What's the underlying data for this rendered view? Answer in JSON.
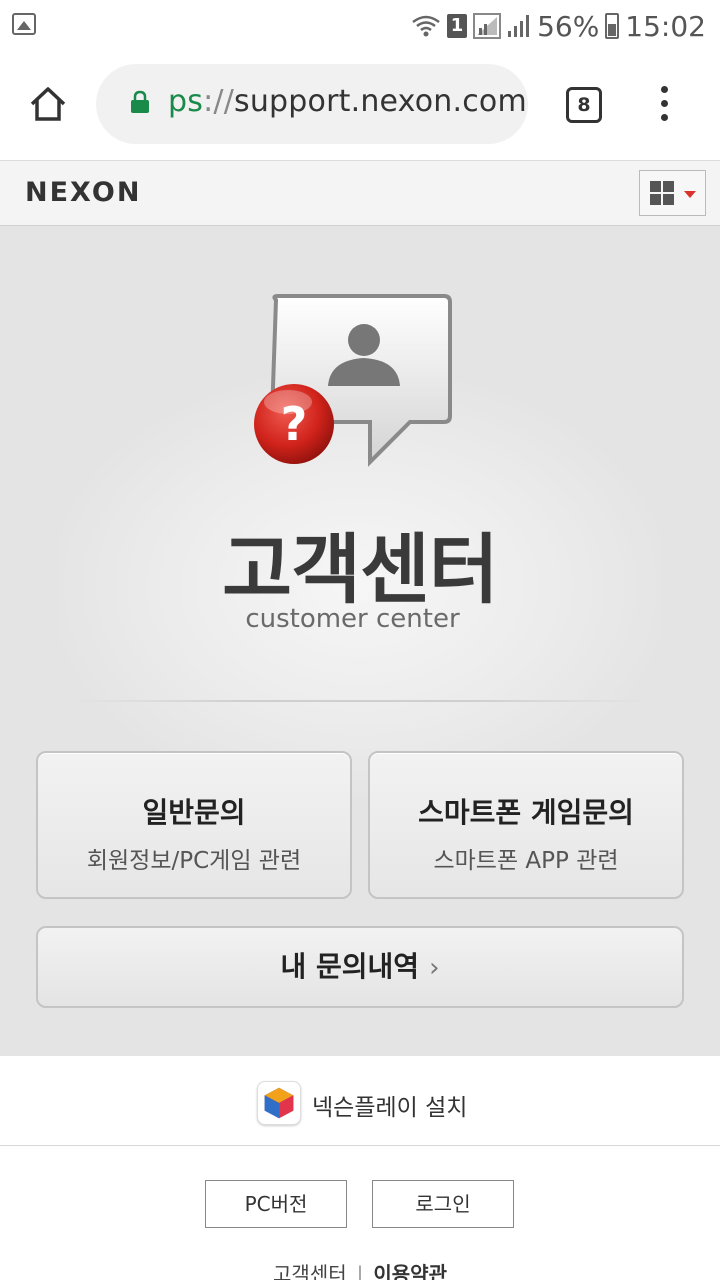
{
  "status_bar": {
    "sim_slot": "1",
    "battery": "56%",
    "time": "15:02"
  },
  "browser": {
    "url_scheme": "ps",
    "url_sep": "://",
    "url_host": "support.nexon.com",
    "tab_count": "8"
  },
  "header": {
    "logo": "NEXON"
  },
  "hero": {
    "title": "고객센터",
    "subtitle": "customer center"
  },
  "cards": [
    {
      "title": "일반문의",
      "desc": "회원정보/PC게임 관련"
    },
    {
      "title": "스마트폰 게임문의",
      "desc": "스마트폰 APP 관련"
    }
  ],
  "history": {
    "label": "내 문의내역",
    "chevron": "›"
  },
  "footer": {
    "install_label": "넥슨플레이 설치",
    "pc_version": "PC버전",
    "login": "로그인",
    "link_cs": "고객센터",
    "link_sep": "|",
    "link_terms": "이용약관"
  },
  "icons": {
    "status_left": "image-icon",
    "home": "home-icon",
    "lock": "lock-icon",
    "menu": "more-vert-icon",
    "grid": "apps-grid-icon",
    "hero": "customer-support-icon",
    "play": "nexon-play-icon"
  },
  "colors": {
    "accent_red": "#d9332a",
    "secure_green": "#1a8a4a",
    "main_bg": "#e4e4e4"
  }
}
